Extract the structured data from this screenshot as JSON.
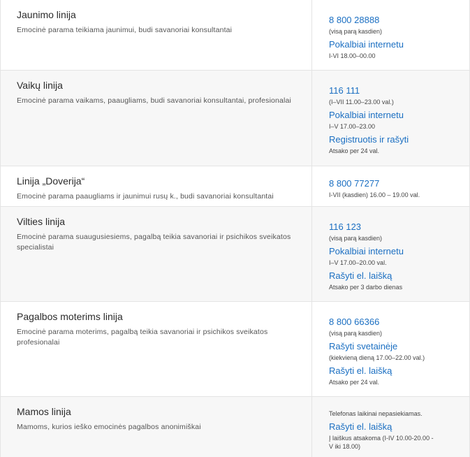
{
  "lines": [
    {
      "title": "Jaunimo linija",
      "desc": "Emocinė parama teikiama jaunimui, budi savanoriai konsultantai",
      "items": [
        {
          "kind": "link",
          "text": "8 800 28888"
        },
        {
          "kind": "note",
          "text": "(visą parą kasdien)"
        },
        {
          "kind": "link",
          "text": "Pokalbiai internetu"
        },
        {
          "kind": "note",
          "text": "I-VI 18.00–00.00"
        }
      ]
    },
    {
      "title": "Vaikų linija",
      "desc": "Emocinė parama vaikams, paaugliams, budi savanoriai konsultantai, profesionalai",
      "items": [
        {
          "kind": "link",
          "text": "116 111"
        },
        {
          "kind": "note",
          "text": "(I–VII 11.00–23.00 val.)"
        },
        {
          "kind": "link",
          "text": "Pokalbiai internetu"
        },
        {
          "kind": "note",
          "text": "I–V 17.00–23.00"
        },
        {
          "kind": "link",
          "text": "Registruotis ir rašyti"
        },
        {
          "kind": "note",
          "text": "Atsako per 24 val."
        }
      ]
    },
    {
      "title": "Linija „Doverija“",
      "desc": "Emocinė parama paaugliams ir jaunimui rusų k., budi savanoriai konsultantai",
      "items": [
        {
          "kind": "link",
          "text": "8 800 77277"
        },
        {
          "kind": "note",
          "text": "I-VII (kasdien) 16.00 – 19.00 val."
        }
      ]
    },
    {
      "title": "Vilties linija",
      "desc": "Emocinė parama suaugusiesiems, pagalbą teikia savanoriai ir psichikos sveikatos specialistai",
      "items": [
        {
          "kind": "link",
          "text": "116 123"
        },
        {
          "kind": "note",
          "text": "(visą parą kasdien)"
        },
        {
          "kind": "link",
          "text": "Pokalbiai internetu"
        },
        {
          "kind": "note",
          "text": "I–V 17.00–20.00 val."
        },
        {
          "kind": "link",
          "text": "Rašyti el. laišką"
        },
        {
          "kind": "note",
          "text": "Atsako per 3 darbo dienas"
        }
      ]
    },
    {
      "title": "Pagalbos moterims linija",
      "desc": "Emocinė parama moterims, pagalbą teikia savanoriai ir psichikos sveikatos profesionalai",
      "items": [
        {
          "kind": "link",
          "text": "8 800 66366"
        },
        {
          "kind": "note",
          "text": "(visą parą kasdien)"
        },
        {
          "kind": "link",
          "text": "Rašyti svetainėje"
        },
        {
          "kind": "note",
          "text": "(kiekvieną dieną 17.00–22.00 val.)"
        },
        {
          "kind": "link",
          "text": "Rašyti el. laišką"
        },
        {
          "kind": "note",
          "text": "Atsako per 24 val."
        }
      ]
    },
    {
      "title": "Mamos linija",
      "desc": "Mamoms, kurios ieško emocinės pagalbos anonimiškai",
      "items": [
        {
          "kind": "note",
          "text": "Telefonas laikinai nepasiekiamas."
        },
        {
          "kind": "link",
          "text": "Rašyti el. laišką"
        },
        {
          "kind": "note",
          "text": "Į laiškus atsakoma (I-IV 10.00-20.00 - V iki 18.00)"
        }
      ]
    }
  ]
}
